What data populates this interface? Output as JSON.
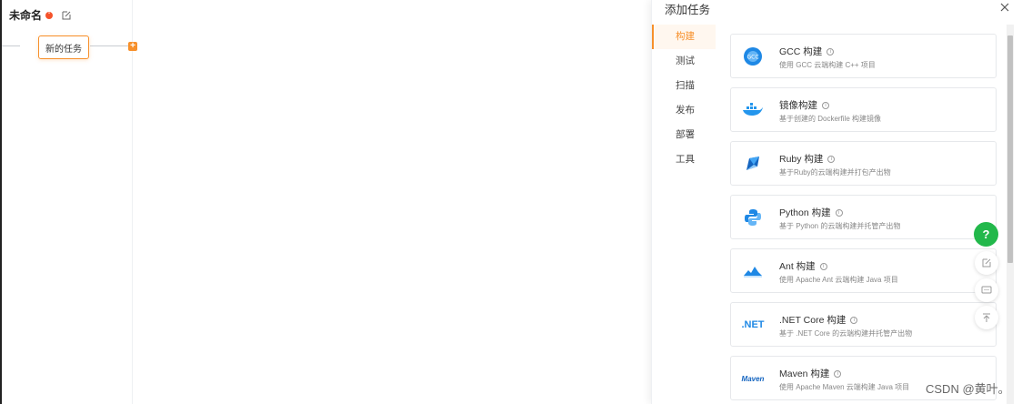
{
  "pipeline": {
    "title": "未命名",
    "task_node_label": "新的任务"
  },
  "drawer": {
    "title": "添加任务",
    "close_label": "X",
    "categories": [
      "构建",
      "测试",
      "扫描",
      "发布",
      "部署",
      "工具"
    ],
    "active_category": "构建",
    "tasks": [
      {
        "name": "GCC 构建",
        "desc": "使用 GCC 云端构建 C++ 项目",
        "logo": "gcc-logo"
      },
      {
        "name": "镜像构建",
        "desc": "基于创建的 Dockerfile 构建镜像",
        "logo": "docker-logo"
      },
      {
        "name": "Ruby 构建",
        "desc": "基于Ruby的云端构建并打包产出物",
        "logo": "ruby-logo"
      },
      {
        "name": "Python 构建",
        "desc": "基于 Python 的云端构建并托管产出物",
        "logo": "python-logo"
      },
      {
        "name": "Ant 构建",
        "desc": "使用 Apache Ant 云端构建 Java 项目",
        "logo": "ant-logo"
      },
      {
        "name": ".NET Core 构建",
        "desc": "基于 .NET Core 的云端构建并托管产出物",
        "logo": "dotnet-logo",
        "logo_text": ".NET"
      },
      {
        "name": "Maven 构建",
        "desc": "使用 Apache Maven 云端构建 Java 项目",
        "logo": "maven-logo",
        "logo_text": "Maven"
      }
    ]
  },
  "help": {
    "label": "?"
  },
  "watermark": "CSDN @黄叶。",
  "colors": {
    "accent": "#f7902b",
    "help": "#22b84b",
    "warn": "#f5532b"
  }
}
